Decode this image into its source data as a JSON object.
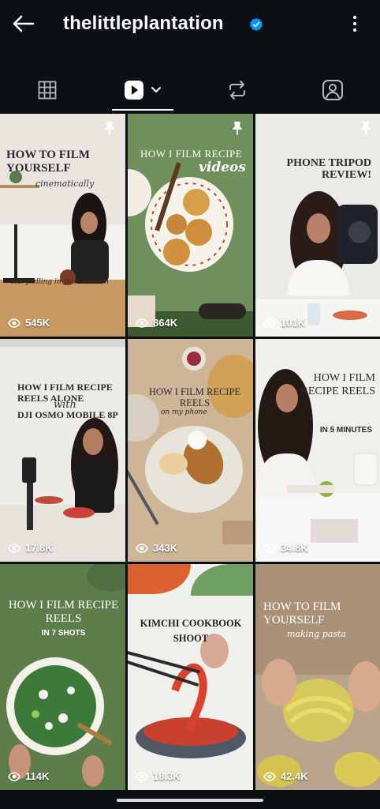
{
  "header": {
    "username": "thelittleplantation",
    "back_icon": "arrow-left-icon",
    "verified_icon": "verified-badge-icon",
    "more_icon": "more-vertical-icon",
    "verified_color": "#0095f6"
  },
  "tabs": [
    {
      "name": "grid",
      "icon": "grid-icon",
      "active": false
    },
    {
      "name": "reels",
      "icon": "reels-play-icon",
      "active": true
    },
    {
      "name": "reposts",
      "icon": "repost-icon",
      "active": false
    },
    {
      "name": "tagged",
      "icon": "tagged-person-icon",
      "active": false
    }
  ],
  "posts": [
    {
      "title": "HOW TO FILM YOURSELF",
      "script": "cinematically",
      "footer_script": "storytelling in your kitchen",
      "views": "545K",
      "pinned": true
    },
    {
      "title": "HOW I FILM RECIPE",
      "script": "videos",
      "views": "864K",
      "pinned": true
    },
    {
      "title": "PHONE TRIPOD REVIEW!",
      "views": "101K",
      "pinned": true
    },
    {
      "title": "HOW I FILM RECIPE REELS ALONE",
      "script": "with",
      "title2": "DJI OSMO MOBILE 8P",
      "views": "17.8K",
      "pinned": false
    },
    {
      "title": "HOW I FILM RECIPE REELS",
      "script": "on my phone",
      "views": "343K",
      "pinned": false
    },
    {
      "title": "HOW I FILM RECIPE REELS",
      "subtitle": "IN 5 MINUTES",
      "views": "34.8K",
      "pinned": false
    },
    {
      "title": "HOW I FILM RECIPE REELS",
      "subtitle": "IN 7 SHOTS",
      "views": "114K",
      "pinned": false
    },
    {
      "title": "KIMCHI COOKBOOK SHOOT",
      "views": "18.3K",
      "pinned": false
    },
    {
      "title": "HOW TO FILM YOURSELF",
      "script": "making pasta",
      "views": "42.4K",
      "pinned": false
    }
  ]
}
